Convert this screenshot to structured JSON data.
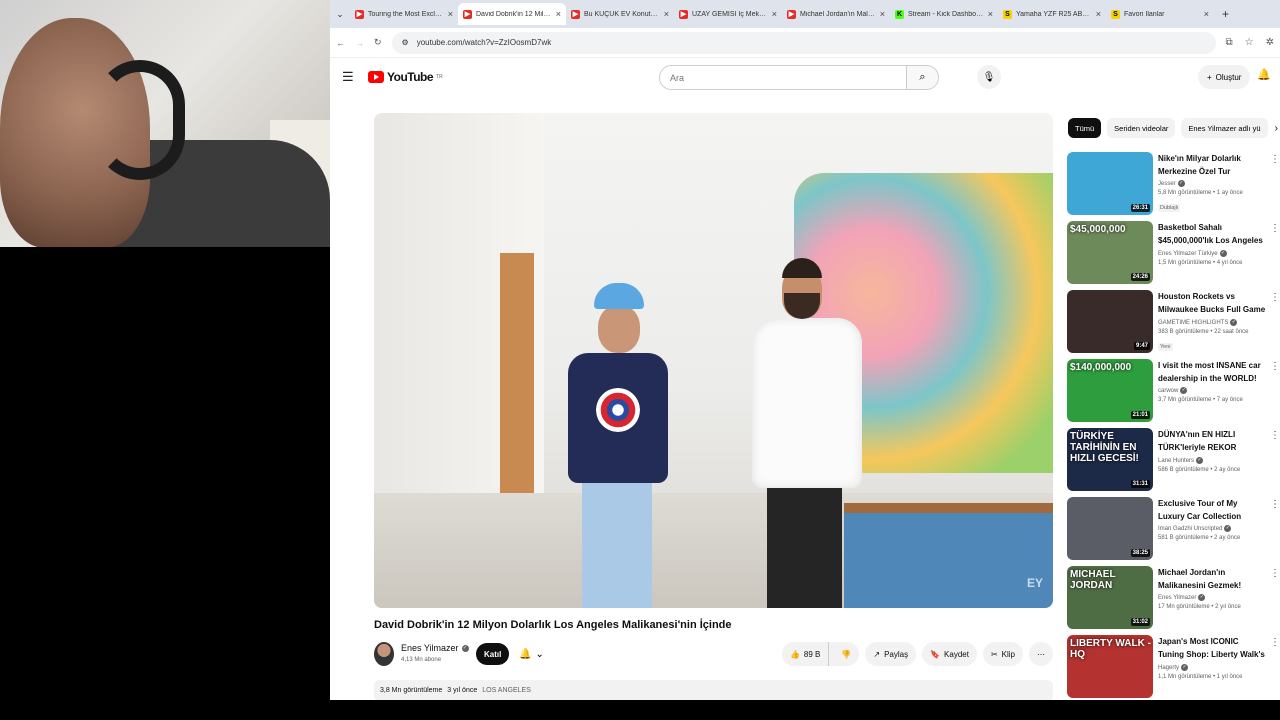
{
  "tabs": [
    {
      "title": "Touring the Most Exclusive",
      "favicon": "yt",
      "active": false
    },
    {
      "title": "David Dobrik'in 12 Milyon",
      "favicon": "yt",
      "active": true
    },
    {
      "title": "Bu KÜÇÜK EV Konutun Gö",
      "favicon": "yt",
      "active": false
    },
    {
      "title": "UZAY GEMİSİ İç Mekanına",
      "favicon": "yt",
      "active": false
    },
    {
      "title": "Michael Jordan'ın Malikan",
      "favicon": "yt",
      "active": false
    },
    {
      "title": "Stream - Kick Dashboard",
      "favicon": "kick",
      "active": false
    },
    {
      "title": "Yamaha YZF R25 ABS 20..",
      "favicon": "s",
      "active": false
    },
    {
      "title": "Favori İlanlar",
      "favicon": "s",
      "active": false
    }
  ],
  "address": {
    "url": "youtube.com/watch?v=ZzIOosmD7wk"
  },
  "header": {
    "logo_text": "YouTube",
    "logo_region": "TR",
    "search_placeholder": "Ara",
    "create_label": "Oluştur"
  },
  "video": {
    "title": "David Dobrik'in 12 Milyon Dolarlık Los Angeles Malikanesi'nin İçinde",
    "watermark": "EY",
    "channel": "Enes Yilmazer",
    "subscribers": "4,13 Mn abone",
    "join_label": "Katıl",
    "likes": "89 B",
    "share_label": "Paylaş",
    "save_label": "Kaydet",
    "clip_label": "Klip",
    "views": "3,8 Mn görüntüleme",
    "date": "3 yıl önce",
    "location": "LOS ANGELES"
  },
  "chips": [
    "Tümü",
    "Seriden videolar",
    "Enes Yilmazer adlı yü"
  ],
  "recommendations": [
    {
      "title": "Nike'ın Milyar Dolarlık Merkezine Özel Tur",
      "channel": "Jesser",
      "meta": "5,8 Mn görüntüleme • 1 ay önce",
      "badge": "Dublajlı",
      "duration": "26:31",
      "thumb_text": "",
      "thumb_color": "#3fa7d6"
    },
    {
      "title": "Basketbol Sahalı $45,000,000'lık Los Angeles ...",
      "channel": "Enes Yilmazer Türkiye",
      "meta": "1,5 Mn görüntüleme • 4 yıl önce",
      "badge": "",
      "duration": "24:26",
      "thumb_text": "$45,000,000",
      "thumb_color": "#6d8a5a"
    },
    {
      "title": "Houston Rockets vs Milwaukee Bucks Full Game Highlights - ...",
      "channel": "GAMETIME HIGHLIGHTS",
      "meta": "383 B görüntüleme • 22 saat önce",
      "badge": "Yeni",
      "duration": "9:47",
      "thumb_text": "",
      "thumb_color": "#3a2b2b"
    },
    {
      "title": "I visit the most INSANE car dealership in the WORLD!",
      "channel": "carwow",
      "meta": "3,7 Mn görüntüleme • 7 ay önce",
      "badge": "",
      "duration": "21:01",
      "thumb_text": "$140,000,000",
      "thumb_color": "#2e9d3d"
    },
    {
      "title": "DÜNYA'nın EN HIZLI TÜRK'leriyle REKOR KIRDIK!",
      "channel": "Lane Hunters",
      "meta": "586 B görüntüleme • 2 ay önce",
      "badge": "",
      "duration": "31:31",
      "thumb_text": "TÜRKİYE TARİHİNİN EN HIZLI GECESİ!",
      "thumb_color": "#1c2a48"
    },
    {
      "title": "Exclusive Tour of My Luxury Car Collection",
      "channel": "Iman Gadzhi Unscripted",
      "meta": "581 B görüntüleme • 2 ay önce",
      "badge": "",
      "duration": "38:25",
      "thumb_text": "",
      "thumb_color": "#5a5d66"
    },
    {
      "title": "Michael Jordan'ın Malikanesini Gezmek!",
      "channel": "Enes Yilmazer",
      "meta": "17 Mn görüntüleme • 2 yıl önce",
      "badge": "",
      "duration": "31:02",
      "thumb_text": "MICHAEL JORDAN",
      "thumb_color": "#4f6d44"
    },
    {
      "title": "Japan's Most ICONIC Tuning Shop: Liberty Walk's Massive ...",
      "channel": "Hagerty",
      "meta": "1,1 Mn görüntüleme • 1 yıl önce",
      "badge": "",
      "duration": "",
      "thumb_text": "LIBERTY WALK - HQ",
      "thumb_color": "#b4322f"
    }
  ]
}
